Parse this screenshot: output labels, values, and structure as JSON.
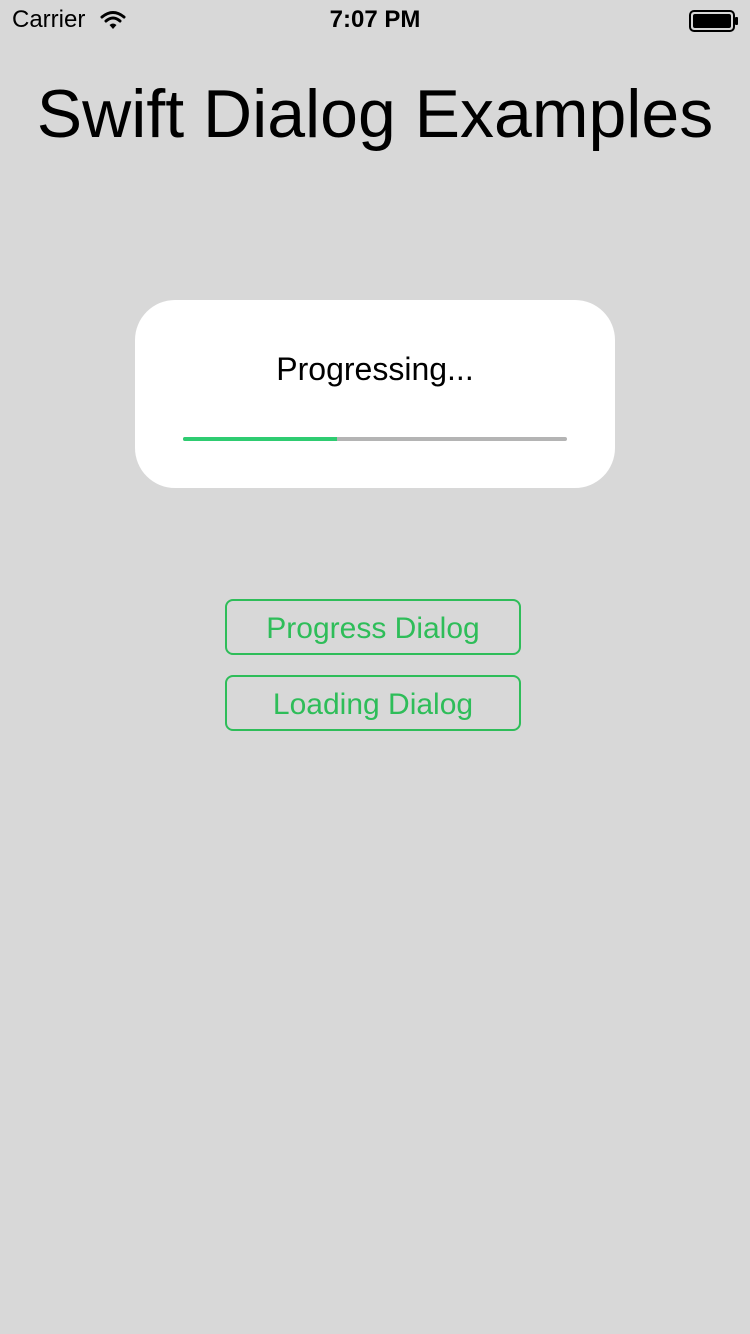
{
  "status_bar": {
    "carrier": "Carrier",
    "time": "7:07 PM",
    "wifi_icon": "wifi-icon",
    "battery_icon": "battery-icon"
  },
  "title": "Swift Dialog Examples",
  "dialog": {
    "message": "Progressing...",
    "progress": 0.4,
    "progress_color": "#2ecc71",
    "track_color": "#b4b4b4"
  },
  "buttons": {
    "progress_dialog": "Progress Dialog",
    "loading_dialog": "Loading Dialog"
  },
  "colors": {
    "background": "#d8d8d8",
    "accent": "#2ebd59"
  }
}
